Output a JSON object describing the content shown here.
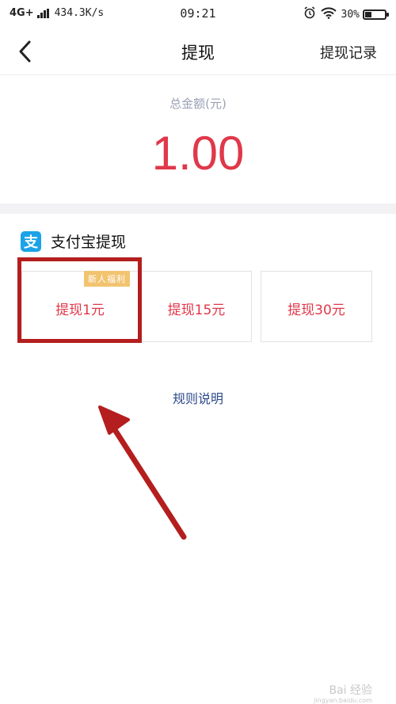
{
  "status_bar": {
    "network": "4G+",
    "speed": "434.3K/s",
    "time": "09:21",
    "battery": "30%",
    "battery_level": 0.3
  },
  "nav": {
    "back_icon": "chevron-left-icon",
    "title": "提现",
    "record_label": "提现记录"
  },
  "total": {
    "label": "总金额(元)",
    "amount": "1.00"
  },
  "alipay": {
    "icon_char": "支",
    "title": "支付宝提现",
    "options": [
      {
        "label": "提现1元",
        "badge": "新人福利"
      },
      {
        "label": "提现15元"
      },
      {
        "label": "提现30元"
      }
    ]
  },
  "rules_label": "规则说明",
  "watermark": {
    "text": "Bai 经验",
    "sub": "jingyan.baidu.com"
  },
  "colors": {
    "accent_red": "#e0384a",
    "annotation_red": "#b41e1e",
    "alipay_blue": "#1aa3e8",
    "badge_gold": "#f2c470",
    "link_blue": "#2e4b8c"
  }
}
